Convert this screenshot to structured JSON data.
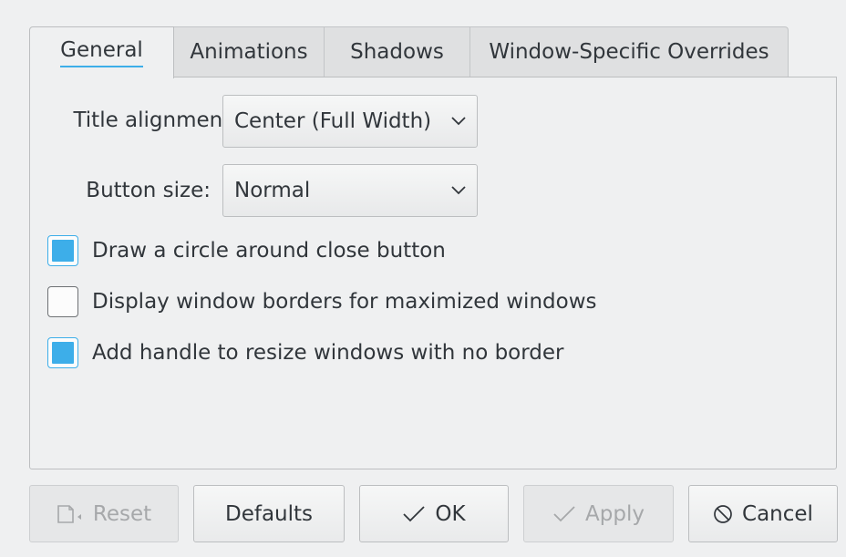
{
  "tabs": [
    {
      "label": "General",
      "active": true
    },
    {
      "label": "Animations",
      "active": false
    },
    {
      "label": "Shadows",
      "active": false
    },
    {
      "label": "Window-Specific Overrides",
      "active": false
    }
  ],
  "general": {
    "title_alignment": {
      "label": "Title alignment:",
      "value": "Center (Full Width)"
    },
    "button_size": {
      "label": "Button size:",
      "value": "Normal"
    },
    "checkboxes": [
      {
        "label": "Draw a circle around close button",
        "checked": true
      },
      {
        "label": "Display window borders for maximized windows",
        "checked": false
      },
      {
        "label": "Add handle to resize windows with no border",
        "checked": true
      }
    ]
  },
  "buttons": {
    "reset": {
      "label": "Reset",
      "icon": "document-revert-icon",
      "enabled": false
    },
    "defaults": {
      "label": "Defaults",
      "enabled": true
    },
    "ok": {
      "label": "OK",
      "icon": "checkmark-icon",
      "enabled": true
    },
    "apply": {
      "label": "Apply",
      "icon": "checkmark-icon",
      "enabled": false
    },
    "cancel": {
      "label": "Cancel",
      "icon": "cancel-circle-icon",
      "enabled": true
    }
  },
  "colors": {
    "accent": "#3daee9",
    "background": "#eff0f1",
    "text": "#31363b",
    "disabled_text": "#a6a8aa"
  }
}
